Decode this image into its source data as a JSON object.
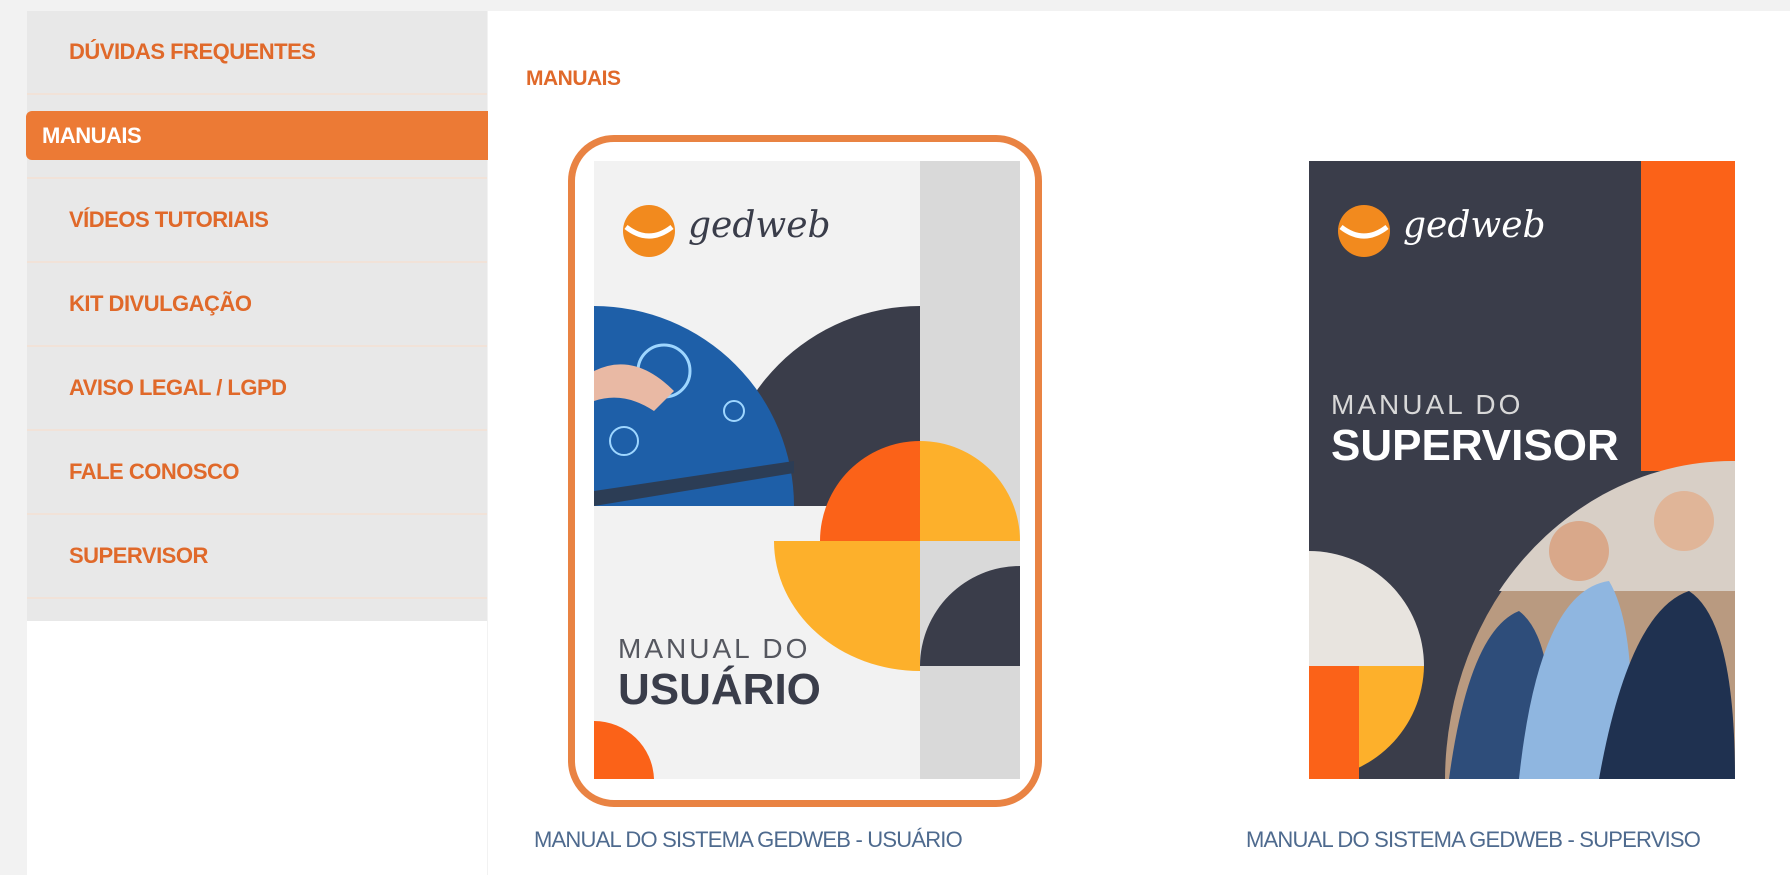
{
  "sidebar": {
    "items": [
      {
        "label": "DÚVIDAS FREQUENTES"
      },
      {
        "label": "MANUAIS"
      },
      {
        "label": "VÍDEOS TUTORIAIS"
      },
      {
        "label": "KIT DIVULGAÇÃO"
      },
      {
        "label": "AVISO LEGAL / LGPD"
      },
      {
        "label": "FALE CONOSCO"
      },
      {
        "label": "SUPERVISOR"
      }
    ]
  },
  "main": {
    "title": "MANUAIS",
    "manuals": [
      {
        "caption": "MANUAL DO SISTEMA GEDWEB - USUÁRIO",
        "cover_brand": "gedweb",
        "cover_small": "MANUAL DO",
        "cover_big": "USUÁRIO"
      },
      {
        "caption": "MANUAL DO SISTEMA GEDWEB - SUPERVISO",
        "cover_brand": "gedweb",
        "cover_small": "MANUAL DO",
        "cover_big": "SUPERVISOR"
      }
    ]
  },
  "colors": {
    "accent": "#ec7a35",
    "accent_text": "#e0692a",
    "link": "#4e6a8e",
    "dark": "#3a3d4a",
    "orange_deep": "#fb6218",
    "yellow": "#fdb02b"
  }
}
